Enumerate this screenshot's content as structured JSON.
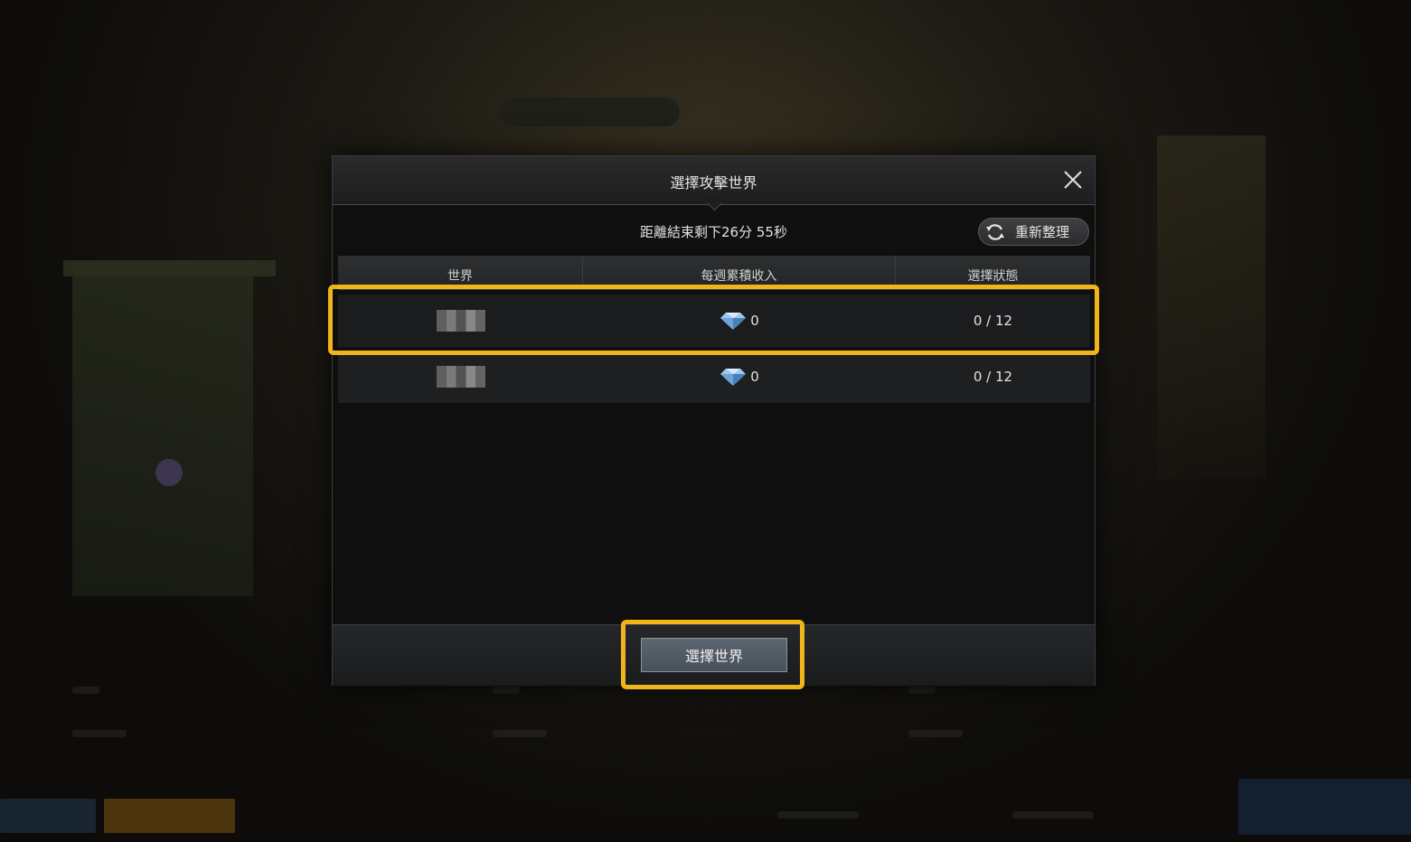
{
  "dialog": {
    "title": "選擇攻擊世界",
    "timer_text": "距離結束剩下26分 55秒",
    "refresh_label": "重新整理",
    "select_button_label": "選擇世界"
  },
  "table": {
    "columns": [
      "世界",
      "每週累積收入",
      "選擇狀態"
    ],
    "rows": [
      {
        "world": "",
        "income": "0",
        "status": "0 / 12",
        "highlighted": true
      },
      {
        "world": "",
        "income": "0",
        "status": "0 / 12",
        "highlighted": false
      }
    ]
  },
  "colors": {
    "highlight": "#f0b51a",
    "dialog_bg": "#0f0f10",
    "select_button": "#5c6670"
  },
  "icons": {
    "close": "close-icon",
    "refresh": "refresh-icon",
    "income": "diamond-icon"
  }
}
